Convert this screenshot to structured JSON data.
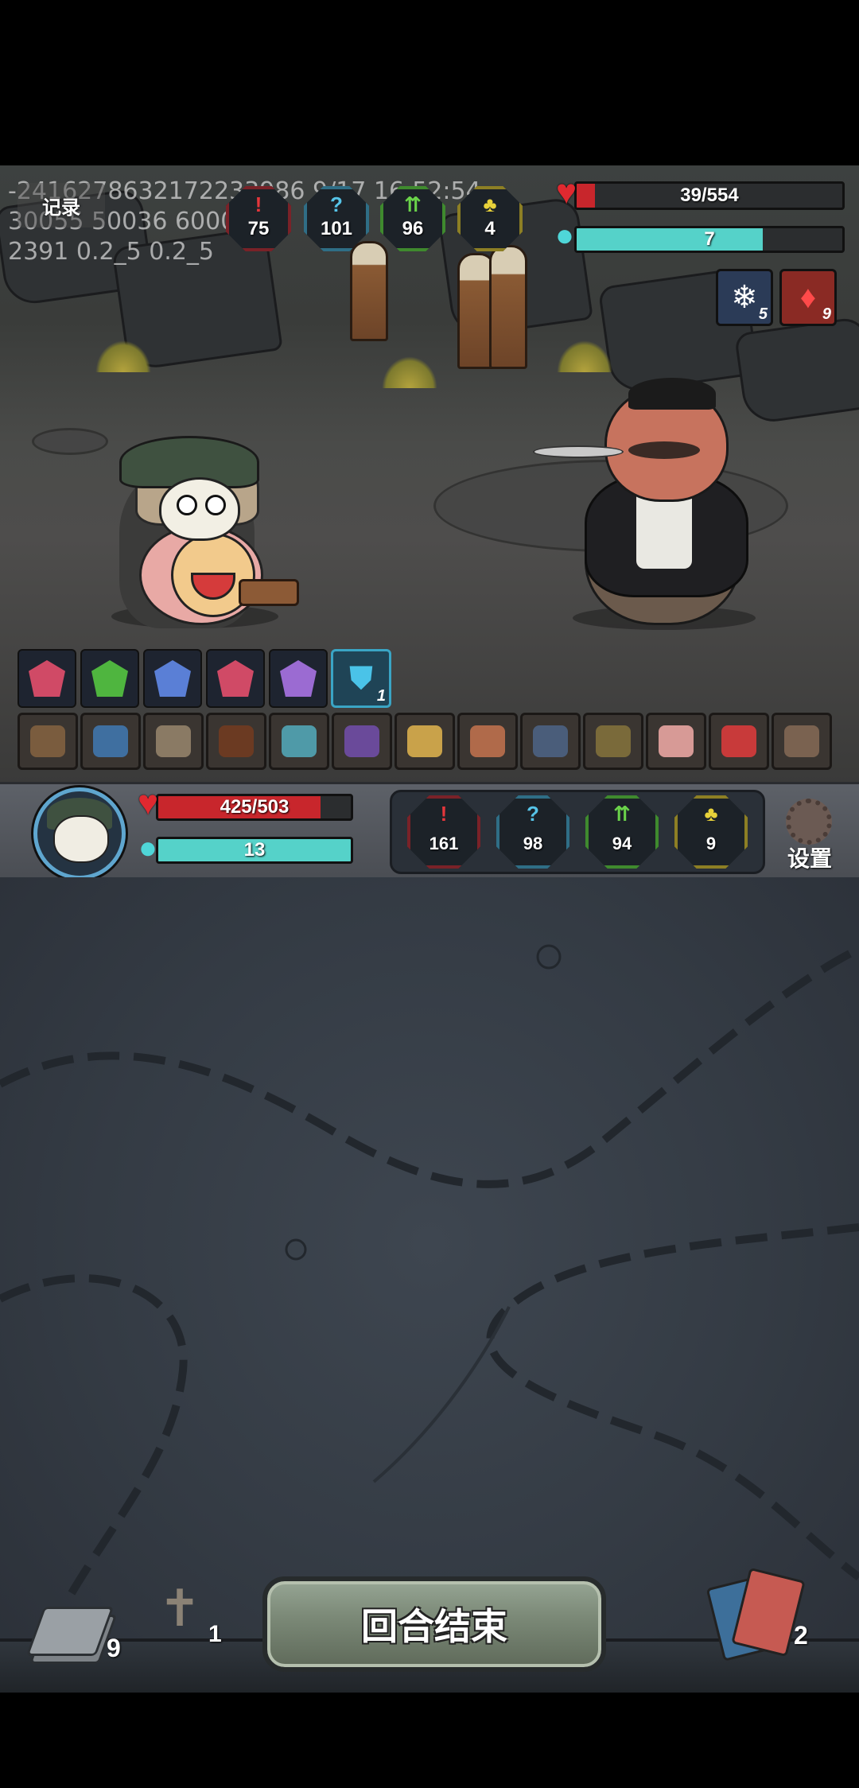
{
  "debug": {
    "line1": "-2416278632172233986 9/17 16:52:54",
    "line2": "30055 50036 600073",
    "line3": "2391 0.2_5 0.2_5"
  },
  "log_button": {
    "label": "记录"
  },
  "enemy": {
    "hp_text": "39/554",
    "hp_fraction": 0.07,
    "mana_value": "7",
    "mana_fraction": 0.7,
    "stats": {
      "attack": "75",
      "defense": "101",
      "agility": "96",
      "luck": "4"
    },
    "statuses": [
      {
        "icon": "snowflake-icon",
        "count": "5",
        "color": "#2b3b57"
      },
      {
        "icon": "blood-drop-icon",
        "count": "9",
        "color": "#8a2a24"
      }
    ]
  },
  "player": {
    "hp_text": "425/503",
    "hp_fraction": 0.845,
    "mana_value": "13",
    "mana_fraction": 1.0,
    "stats": {
      "attack": "161",
      "defense": "98",
      "agility": "94",
      "luck": "9"
    },
    "buff_count": "1"
  },
  "gems": [
    {
      "name": "ruby-gem",
      "color": "#d04a66"
    },
    {
      "name": "emerald-gem",
      "color": "#4fb53f"
    },
    {
      "name": "sapphire-gem",
      "color": "#5a7fd6"
    },
    {
      "name": "ruby-gem",
      "color": "#d04a66"
    },
    {
      "name": "amethyst-gem",
      "color": "#9b6bd2"
    }
  ],
  "items": [
    {
      "name": "wooden-planks-item",
      "color": "#7a5c3e"
    },
    {
      "name": "blue-crystal-item",
      "color": "#3f6fa0"
    },
    {
      "name": "dagger-item",
      "color": "#8a7a64"
    },
    {
      "name": "sack-item",
      "color": "#6b3a22"
    },
    {
      "name": "fish-item",
      "color": "#4f9aa8"
    },
    {
      "name": "spellbook-item",
      "color": "#6a4a9a"
    },
    {
      "name": "ring-item",
      "color": "#c9a24a"
    },
    {
      "name": "meat-item",
      "color": "#b06a4a"
    },
    {
      "name": "wizard-hat-item",
      "color": "#4a5d7a"
    },
    {
      "name": "helmet-item",
      "color": "#7a6a3a"
    },
    {
      "name": "pink-leg-item",
      "color": "#d79a96"
    },
    {
      "name": "rose-item",
      "color": "#c83a3a"
    },
    {
      "name": "owl-item",
      "color": "#7a6250"
    }
  ],
  "settings": {
    "label": "设置"
  },
  "end_turn": {
    "label": "回合结束"
  },
  "piles": {
    "draw_count": "9",
    "exhaust_count": "1",
    "discard_count": "2"
  },
  "colors": {
    "hp_red": "#c8262c",
    "mana_cyan": "#55d2c9",
    "accent_blue": "#5fa6cf"
  }
}
